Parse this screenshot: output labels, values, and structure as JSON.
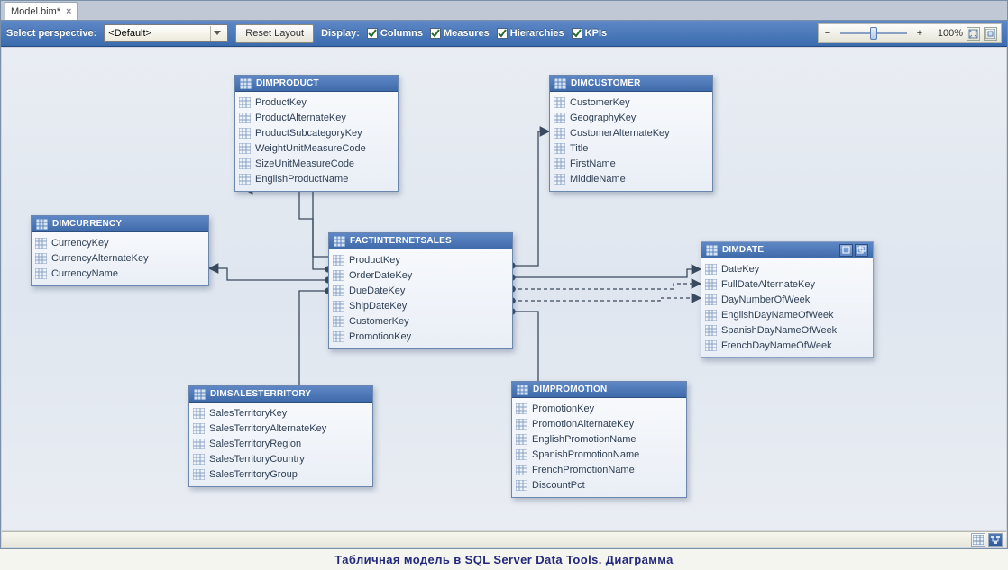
{
  "tab": {
    "title": "Model.bim*"
  },
  "toolbar": {
    "perspective_label": "Select perspective:",
    "perspective_value": "<Default>",
    "reset_label": "Reset Layout",
    "display_label": "Display:",
    "chk_columns": "Columns",
    "chk_measures": "Measures",
    "chk_hierarchies": "Hierarchies",
    "chk_kpis": "KPIs",
    "zoom_pct": "100%"
  },
  "tables": {
    "dimProduct": {
      "title": "DimProduct",
      "cols": [
        "ProductKey",
        "ProductAlternateKey",
        "ProductSubcategoryKey",
        "WeightUnitMeasureCode",
        "SizeUnitMeasureCode",
        "EnglishProductName"
      ]
    },
    "dimCustomer": {
      "title": "DimCustomer",
      "cols": [
        "CustomerKey",
        "GeographyKey",
        "CustomerAlternateKey",
        "Title",
        "FirstName",
        "MiddleName"
      ]
    },
    "dimCurrency": {
      "title": "DimCurrency",
      "cols": [
        "CurrencyKey",
        "CurrencyAlternateKey",
        "CurrencyName"
      ]
    },
    "fact": {
      "title": "FactInternetSales",
      "cols": [
        "ProductKey",
        "OrderDateKey",
        "DueDateKey",
        "ShipDateKey",
        "CustomerKey",
        "PromotionKey"
      ]
    },
    "dimDate": {
      "title": "DimDate",
      "cols": [
        "DateKey",
        "FullDateAlternateKey",
        "DayNumberOfWeek",
        "EnglishDayNameOfWeek",
        "SpanishDayNameOfWeek",
        "FrenchDayNameOfWeek"
      ]
    },
    "dimSalesTerritory": {
      "title": "DimSalesTerritory",
      "cols": [
        "SalesTerritoryKey",
        "SalesTerritoryAlternateKey",
        "SalesTerritoryRegion",
        "SalesTerritoryCountry",
        "SalesTerritoryGroup"
      ]
    },
    "dimPromotion": {
      "title": "DimPromotion",
      "cols": [
        "PromotionKey",
        "PromotionAlternateKey",
        "EnglishPromotionName",
        "SpanishPromotionName",
        "FrenchPromotionName",
        "DiscountPct"
      ]
    }
  },
  "caption": "Табличная модель в SQL Server Data Tools. Диаграмма"
}
